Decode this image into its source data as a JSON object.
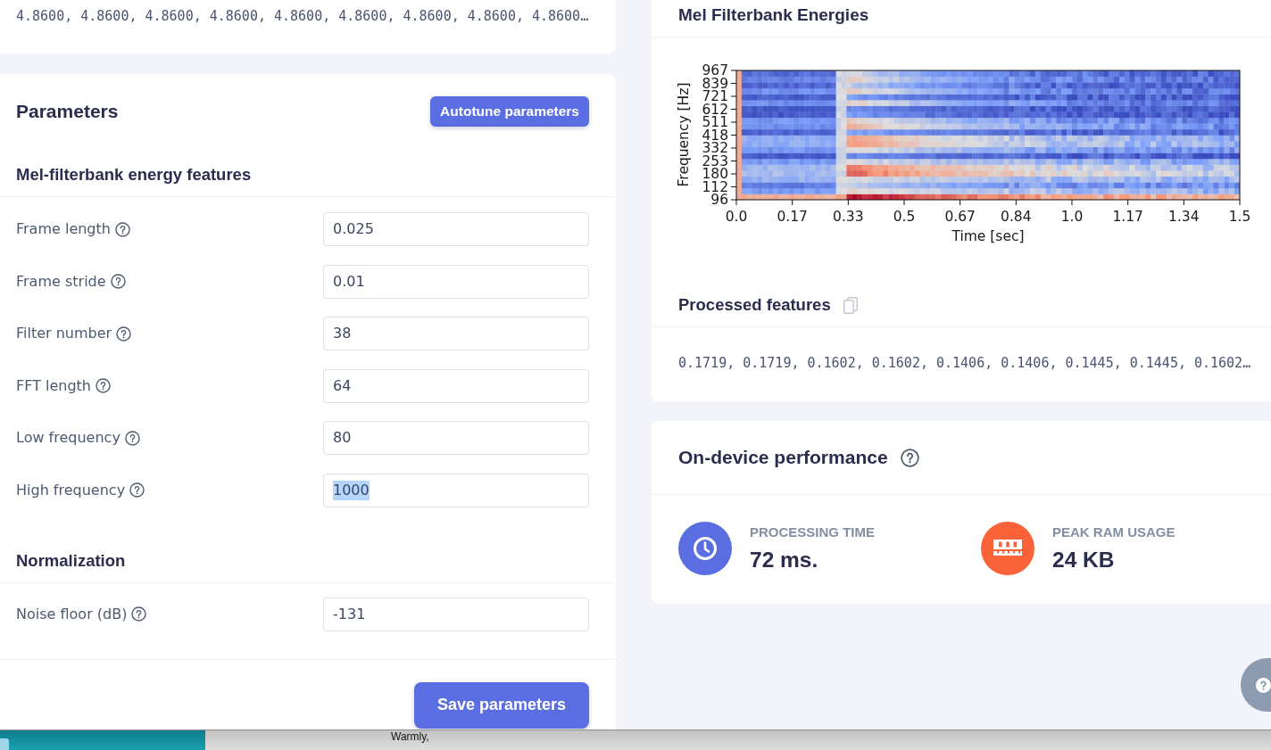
{
  "top_card": {
    "values": "4.8600, 4.8600, 4.8600, 4.8600, 4.8600, 4.8600, 4.8600, 4.8600, 4.8600…"
  },
  "parameters": {
    "title": "Parameters",
    "autotune_button": "Autotune parameters",
    "sections": [
      {
        "title": "Mel-filterbank energy features",
        "fields": [
          {
            "label": "Frame length",
            "value": "0.025",
            "selected": false
          },
          {
            "label": "Frame stride",
            "value": "0.01",
            "selected": false
          },
          {
            "label": "Filter number",
            "value": "38",
            "selected": false
          },
          {
            "label": "FFT length",
            "value": "64",
            "selected": false
          },
          {
            "label": "Low frequency",
            "value": "80",
            "selected": false
          },
          {
            "label": "High frequency",
            "value": "1000",
            "selected": true
          }
        ]
      },
      {
        "title": "Normalization",
        "fields": [
          {
            "label": "Noise floor (dB)",
            "value": "-131",
            "selected": false
          }
        ]
      }
    ],
    "save_button": "Save parameters"
  },
  "mel_filterbank": {
    "title": "Mel Filterbank Energies",
    "spectrogram": {
      "ylabel": "Frequency [Hz]",
      "xlabel": "Time [sec]",
      "yticks": [
        "967",
        "839",
        "721",
        "612",
        "511",
        "418",
        "332",
        "253",
        "180",
        "112",
        "96"
      ],
      "xticks": [
        "0.0",
        "0.17",
        "0.33",
        "0.5",
        "0.67",
        "0.84",
        "1.0",
        "1.17",
        "1.34",
        "1.5"
      ]
    },
    "processed_features": {
      "title": "Processed features",
      "values": "0.1719, 0.1719, 0.1602, 0.1602, 0.1406, 0.1406, 0.1445, 0.1445, 0.1602…"
    }
  },
  "performance": {
    "title": "On-device performance",
    "metrics": [
      {
        "kind": "time",
        "label": "PROCESSING TIME",
        "value": "72 ms.",
        "color": "#5b6ee1"
      },
      {
        "kind": "memory",
        "label": "PEAK RAM USAGE",
        "value": "24 KB",
        "color": "#fa6239"
      }
    ]
  },
  "background_window": {
    "text": "Warmly,"
  }
}
